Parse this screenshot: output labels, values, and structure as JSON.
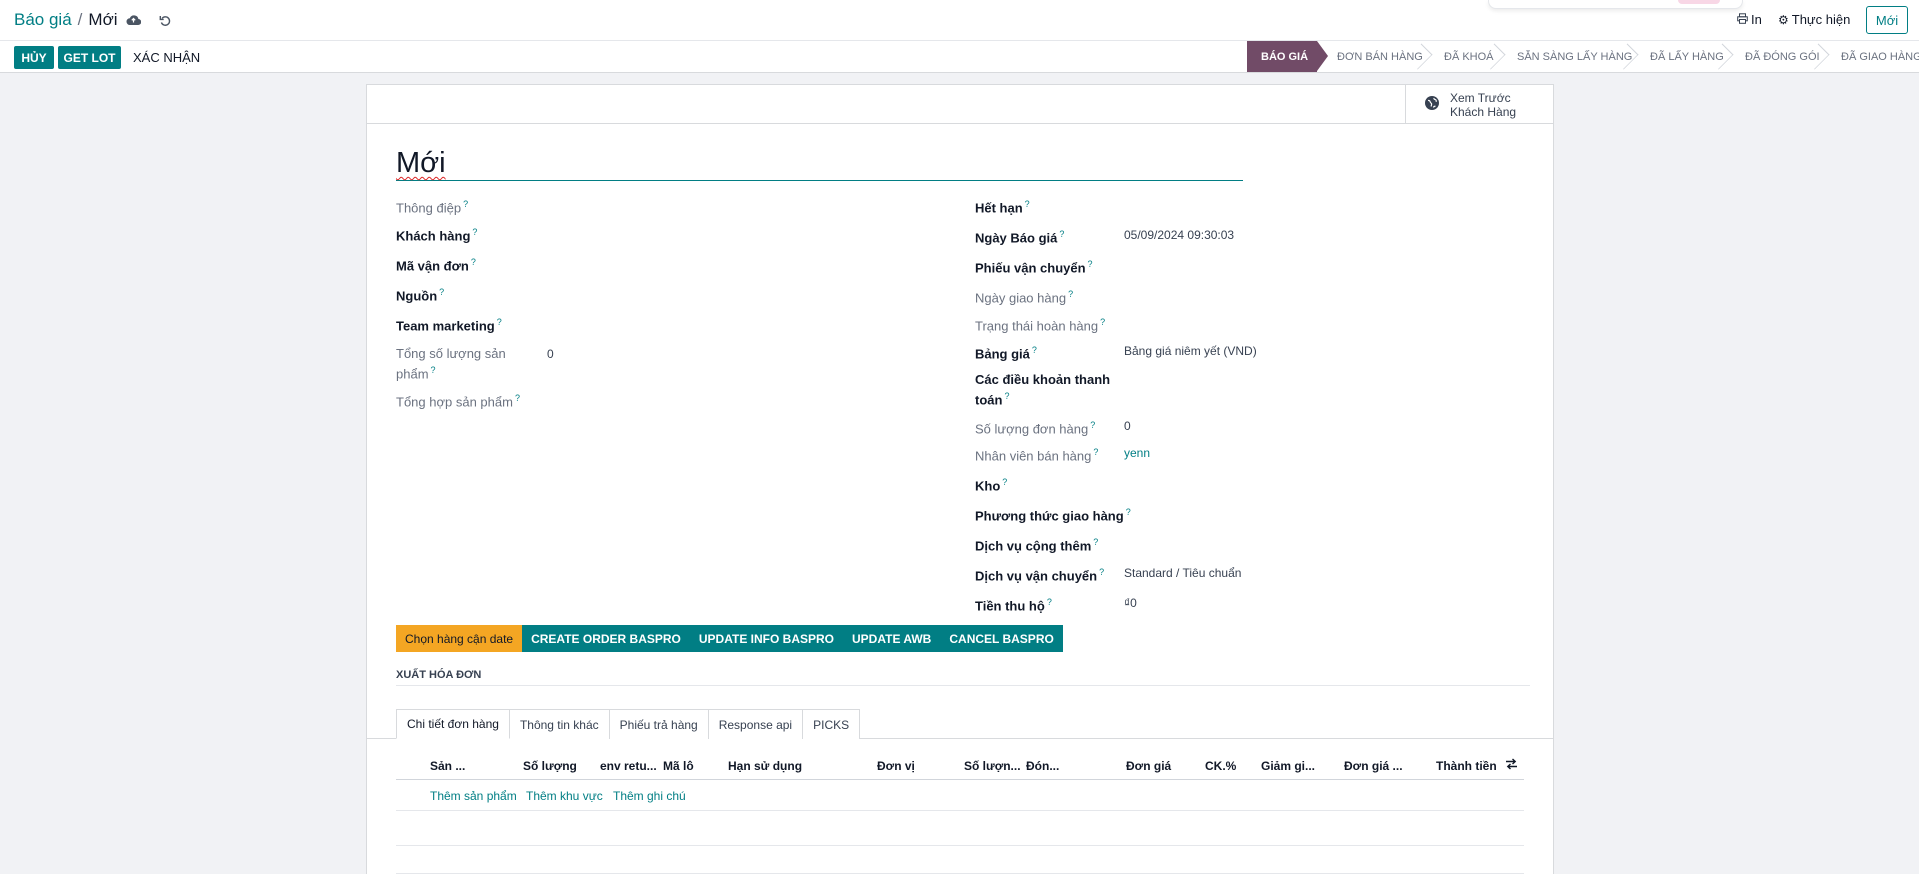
{
  "breadcrumb": {
    "parent": "Báo giá",
    "separator": "/",
    "current": "Mới"
  },
  "top_actions": {
    "print_label": "In",
    "action_label": "Thực hiện",
    "new_label": "Mới"
  },
  "buttons": {
    "cancel": "HỦY",
    "get_lot": "GET LOT",
    "confirm": "XÁC NHẬN"
  },
  "status_steps": [
    "BÁO GIÁ",
    "ĐƠN BÁN HÀNG",
    "ĐÃ KHOÁ",
    "SẴN SÀNG LẤY HÀNG",
    "ĐÃ LẤY HÀNG",
    "ĐÃ ĐÓNG GÓI",
    "ĐÃ GIAO HÀNG"
  ],
  "status_active_index": 0,
  "preview": {
    "line1": "Xem Trước",
    "line2": "Khách Hàng"
  },
  "record_title": "Mới",
  "left_fields": {
    "message": "Thông điệp",
    "customer": "Khách hàng",
    "tracking_code": "Mã vận đơn",
    "source": "Nguồn",
    "marketing_team": "Team marketing",
    "total_qty_line1": "Tổng số lượng sản",
    "total_qty_line2": "phẩm",
    "total_qty_value": "0",
    "product_summary": "Tổng hợp sản phẩm"
  },
  "right_fields": {
    "expiration": "Hết hạn",
    "quote_date": "Ngày Báo giá",
    "quote_date_value": "05/09/2024 09:30:03",
    "shipping_slip": "Phiếu vận chuyển",
    "delivery_date": "Ngày giao hàng",
    "refund_status": "Trạng thái hoàn hàng",
    "pricelist": "Bảng giá",
    "pricelist_value": "Bảng giá niêm yết (VND)",
    "payment_terms_line1": "Các điều khoản thanh",
    "payment_terms_line2": "toán",
    "order_count": "Số lượng đơn hàng",
    "order_count_value": "0",
    "salesperson": "Nhân viên bán hàng",
    "salesperson_value": "yenn",
    "warehouse": "Kho",
    "delivery_method": "Phương thức giao hàng",
    "extra_service": "Dịch vụ cộng thêm",
    "shipping_service": "Dịch vụ vận chuyển",
    "shipping_service_value": "Standard / Tiêu chuẩn",
    "cod": "Tiền thu hộ",
    "cod_value": "₫0"
  },
  "form_buttons": [
    "Chọn hàng cận date",
    "CREATE ORDER BASPRO",
    "UPDATE INFO BASPRO",
    "UPDATE AWB",
    "CANCEL BASPRO"
  ],
  "invoice_section": "XUẤT HÓA ĐƠN",
  "tabs": [
    "Chi tiết đơn hàng",
    "Thông tin khác",
    "Phiếu trả hàng",
    "Response api",
    "PICKS"
  ],
  "table_headers": [
    "Sản ...",
    "Số lượng",
    "env retu...",
    "Mã lô",
    "Hạn sử dụng",
    "Đơn vị",
    "Số lượn...",
    "Đón...",
    "Đơn giá",
    "CK.%",
    "Giảm gi...",
    "Đơn giá ...",
    "Thành tiền"
  ],
  "table_adders": [
    "Thêm sản phẩm",
    "Thêm khu vực",
    "Thêm ghi chú"
  ],
  "colors": {
    "brand": "#017e84",
    "status_active": "#714b67",
    "warning": "#f4a623"
  }
}
